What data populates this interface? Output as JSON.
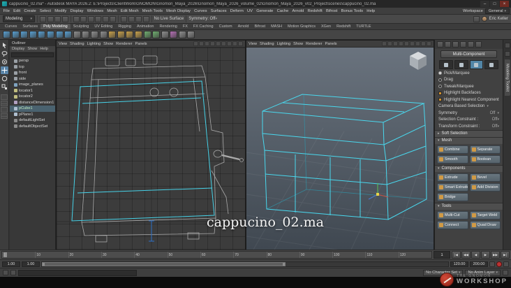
{
  "titlebar": {
    "title": "cappucino_02.ma* - Autodesk MAYA 2026.2: E:\\Projects\\ClientWork\\GNOMON\\Gnomon_Maya_2026\\Gnomon_Maya_2026_volume_02\\Gnomon_Maya_2026_v02_Project\\scenes\\cappucino_02.ma",
    "minimize": "–",
    "maximize": "□",
    "close": "×"
  },
  "menubar": {
    "items": [
      "File",
      "Edit",
      "Create",
      "Select",
      "Modify",
      "Display",
      "Windows",
      "Mesh",
      "Edit Mesh",
      "Mesh Tools",
      "Mesh Display",
      "Curves",
      "Surfaces",
      "Deform",
      "UV",
      "Generate",
      "Cache",
      "Arnold",
      "Redshift",
      "Bifrost",
      "Bonus Tools",
      "Help"
    ],
    "workspace_label": "Workspace",
    "workspace_value": "General"
  },
  "toolbar": {
    "mode": "Modeling",
    "group1": [
      {
        "name": "selection-mask-icon"
      },
      {
        "name": "hierarchy-select-icon"
      },
      {
        "name": "object-select-icon"
      },
      {
        "name": "component-select-icon"
      }
    ],
    "group2": [
      {
        "name": "snap-grid-icon"
      },
      {
        "name": "snap-curve-icon"
      },
      {
        "name": "snap-point-icon"
      },
      {
        "name": "snap-projected-icon"
      },
      {
        "name": "snap-view-icon"
      },
      {
        "name": "make-live-icon"
      }
    ],
    "group3": [
      {
        "name": "construction-history-icon"
      },
      {
        "name": "render-icon"
      },
      {
        "name": "ipr-render-icon"
      },
      {
        "name": "render-settings-icon"
      }
    ],
    "no_live": "No Live Surface",
    "symmetry": "Symmetry: Off",
    "user": "Eric Keller"
  },
  "shelf": {
    "tabs": [
      {
        "label": "Curves"
      },
      {
        "label": "Surfaces"
      },
      {
        "label": "Poly Modeling",
        "active": true
      },
      {
        "label": "Sculpting"
      },
      {
        "label": "UV Editing"
      },
      {
        "label": "Rigging"
      },
      {
        "label": "Animation"
      },
      {
        "label": "Rendering"
      },
      {
        "label": "FX"
      },
      {
        "label": "FX Caching"
      },
      {
        "label": "Custom"
      },
      {
        "label": "Arnold"
      },
      {
        "label": "Bifrost"
      },
      {
        "label": "MASH"
      },
      {
        "label": "Motion Graphics"
      },
      {
        "label": "XGen"
      },
      {
        "label": "Redshift"
      },
      {
        "label": "TURTLE"
      }
    ],
    "icons": [
      {
        "name": "poly-sphere-icon",
        "color": "#57a0d2"
      },
      {
        "name": "poly-cube-icon",
        "color": "#57a0d2"
      },
      {
        "name": "poly-cylinder-icon",
        "color": "#57a0d2"
      },
      {
        "name": "poly-cone-icon",
        "color": "#57a0d2"
      },
      {
        "name": "poly-torus-icon",
        "color": "#57a0d2"
      },
      {
        "name": "poly-plane-icon",
        "color": "#57a0d2"
      },
      {
        "name": "poly-disc-icon",
        "color": "#57a0d2"
      },
      {
        "name": "platonic-solid-icon",
        "color": "#57a0d2"
      },
      {
        "name": "combine-icon",
        "color": "#8f8f8f"
      },
      {
        "name": "separate-icon",
        "color": "#8f8f8f"
      },
      {
        "name": "boolean-icon",
        "color": "#8f8f8f"
      },
      {
        "name": "smooth-icon",
        "color": "#8f8f8f"
      },
      {
        "name": "extrude-icon",
        "color": "#caa24a"
      },
      {
        "name": "bevel-icon",
        "color": "#caa24a"
      },
      {
        "name": "bridge-icon",
        "color": "#caa24a"
      },
      {
        "name": "multi-cut-icon",
        "color": "#caa24a"
      },
      {
        "name": "quad-draw-icon",
        "color": "#6fae6f"
      },
      {
        "name": "target-weld-icon",
        "color": "#6fae6f"
      },
      {
        "name": "mirror-icon",
        "color": "#8f8f8f"
      },
      {
        "name": "lattice-icon",
        "color": "#b46fb4"
      },
      {
        "name": "curve-tool-icon",
        "color": "#8f8f8f"
      },
      {
        "name": "sculpt-tool-icon",
        "color": "#8f8f8f"
      }
    ]
  },
  "toolbox": {
    "tools": [
      {
        "name": "select-tool-icon"
      },
      {
        "name": "lasso-tool-icon"
      },
      {
        "name": "paint-select-tool-icon"
      },
      {
        "name": "move-tool-icon",
        "active": true
      },
      {
        "name": "rotate-tool-icon"
      },
      {
        "name": "scale-tool-icon"
      }
    ]
  },
  "outliner": {
    "title": "Outliner",
    "menus": [
      "Display",
      "Show",
      "Help"
    ],
    "items": [
      {
        "label": "persp",
        "name": "outliner-item-persp",
        "color": "#9aa0a6"
      },
      {
        "label": "top",
        "name": "outliner-item-top",
        "color": "#9aa0a6"
      },
      {
        "label": "front",
        "name": "outliner-item-front",
        "color": "#9aa0a6"
      },
      {
        "label": "side",
        "name": "outliner-item-side",
        "color": "#9aa0a6"
      },
      {
        "label": "image_planes",
        "name": "outliner-item-image-planes",
        "color": "#7fa3c0"
      },
      {
        "label": "locator1",
        "name": "outliner-item-locator1",
        "color": "#c0bd7f"
      },
      {
        "label": "locator2",
        "name": "outliner-item-locator2",
        "color": "#c0bd7f"
      },
      {
        "label": "distanceDimension1",
        "name": "outliner-item-distance-dimension1",
        "color": "#b0a0c0"
      },
      {
        "label": "pCube1",
        "name": "outliner-item-pcube1",
        "color": "#aebfd0",
        "selected": true
      },
      {
        "label": "pPlane1",
        "name": "outliner-item-pplane1",
        "color": "#aebfd0"
      },
      {
        "label": "defaultLightSet",
        "name": "outliner-item-default-light-set",
        "color": "#8a8a8a"
      },
      {
        "label": "defaultObjectSet",
        "name": "outliner-item-default-object-set",
        "color": "#8a8a8a"
      }
    ]
  },
  "viewport": {
    "menus": [
      "View",
      "Shading",
      "Lighting",
      "Show",
      "Renderer",
      "Panels"
    ],
    "icons": [
      {
        "name": "select-camera-icon"
      },
      {
        "name": "lock-camera-icon"
      },
      {
        "name": "camera-attributes-icon"
      },
      {
        "name": "bookmarks-icon"
      },
      {
        "name": "image-plane-icon"
      },
      {
        "name": "wireframe-icon"
      },
      {
        "name": "shaded-icon"
      },
      {
        "name": "textured-icon"
      },
      {
        "name": "lighting-icon"
      }
    ]
  },
  "toolkit": {
    "tab": "Modeling Toolkit",
    "header_icons": [
      {
        "name": "object-mode-icon"
      },
      {
        "name": "vertex-mode-icon"
      },
      {
        "name": "edge-mode-icon"
      },
      {
        "name": "face-mode-icon"
      },
      {
        "name": "uv-mode-icon"
      },
      {
        "name": "multi-mode-icon"
      }
    ],
    "multi_component": "Multi-Component",
    "select_modes": [
      {
        "name": "vertex-component-icon"
      },
      {
        "name": "edge-component-icon"
      },
      {
        "name": "face-component-icon",
        "active": true
      },
      {
        "name": "uv-component-icon"
      }
    ],
    "marquee_options": [
      {
        "label": "Pick/Marquee",
        "selected": true,
        "name": "pick-marquee-radio"
      },
      {
        "label": "Drag",
        "name": "drag-radio"
      },
      {
        "label": "Tweak/Marquee",
        "name": "tweak-marquee-radio"
      }
    ],
    "checkbox1": "Highlight Backfaces",
    "checkbox2": "Highlight Nearest Component",
    "camera_based": "Camera Based Selection",
    "symmetry_label": "Symmetry",
    "symmetry_value": "Off",
    "selection_constraint_label": "Selection Constraint :",
    "selection_constraint_value": "Off",
    "transform_constraint_label": "Transform Constraint :",
    "transform_constraint_value": "Off",
    "soft_selection": "Soft Selection",
    "section_mesh": "Mesh",
    "section_components": "Components",
    "section_tools": "Tools",
    "mesh_buttons": [
      {
        "label": "Combine",
        "name": "combine-button"
      },
      {
        "label": "Separate",
        "name": "separate-button"
      },
      {
        "label": "Smooth",
        "name": "smooth-button"
      },
      {
        "label": "Boolean",
        "name": "boolean-button"
      }
    ],
    "component_buttons": [
      {
        "label": "Extrude",
        "name": "extrude-button"
      },
      {
        "label": "Bevel",
        "name": "bevel-button"
      },
      {
        "label": "Smart Extrude",
        "name": "smart-extrude-button"
      },
      {
        "label": "Add Division",
        "name": "add-division-button"
      },
      {
        "label": "Bridge",
        "name": "bridge-button"
      }
    ],
    "tool_buttons": [
      {
        "label": "Multi-Cut",
        "name": "multi-cut-button"
      },
      {
        "label": "Target Weld",
        "name": "target-weld-button"
      },
      {
        "label": "Connect",
        "name": "connect-button"
      },
      {
        "label": "Quad Draw",
        "name": "quad-draw-button"
      }
    ]
  },
  "timeline": {
    "ticks": [
      "1",
      "10",
      "20",
      "30",
      "40",
      "50",
      "60",
      "70",
      "80",
      "90",
      "100",
      "110",
      "120"
    ],
    "current_frame": "1",
    "transport": [
      {
        "label": "|◀",
        "name": "go-to-start-button"
      },
      {
        "label": "◀◀",
        "name": "step-back-button"
      },
      {
        "label": "◀",
        "name": "play-backwards-button"
      },
      {
        "label": "▶",
        "name": "play-forward-button"
      },
      {
        "label": "▶▶",
        "name": "step-forward-button"
      },
      {
        "label": "▶|",
        "name": "go-to-end-button"
      }
    ]
  },
  "range": {
    "anim_start": "1.00",
    "playback_start": "1.00",
    "playback_end": "120.00",
    "anim_end": "200.00"
  },
  "statusbar": {
    "character_set": "No Character Set",
    "anim_layer": "No Anim Layer"
  },
  "watermark": "cappucino_02.ma",
  "brand": {
    "line1": "THE GNOMON",
    "line2": "WORKSHOP"
  },
  "colors": {
    "wireframe": "#49d8ee",
    "selection_highlight": "#5285a6",
    "autokey": "#bb3333"
  }
}
